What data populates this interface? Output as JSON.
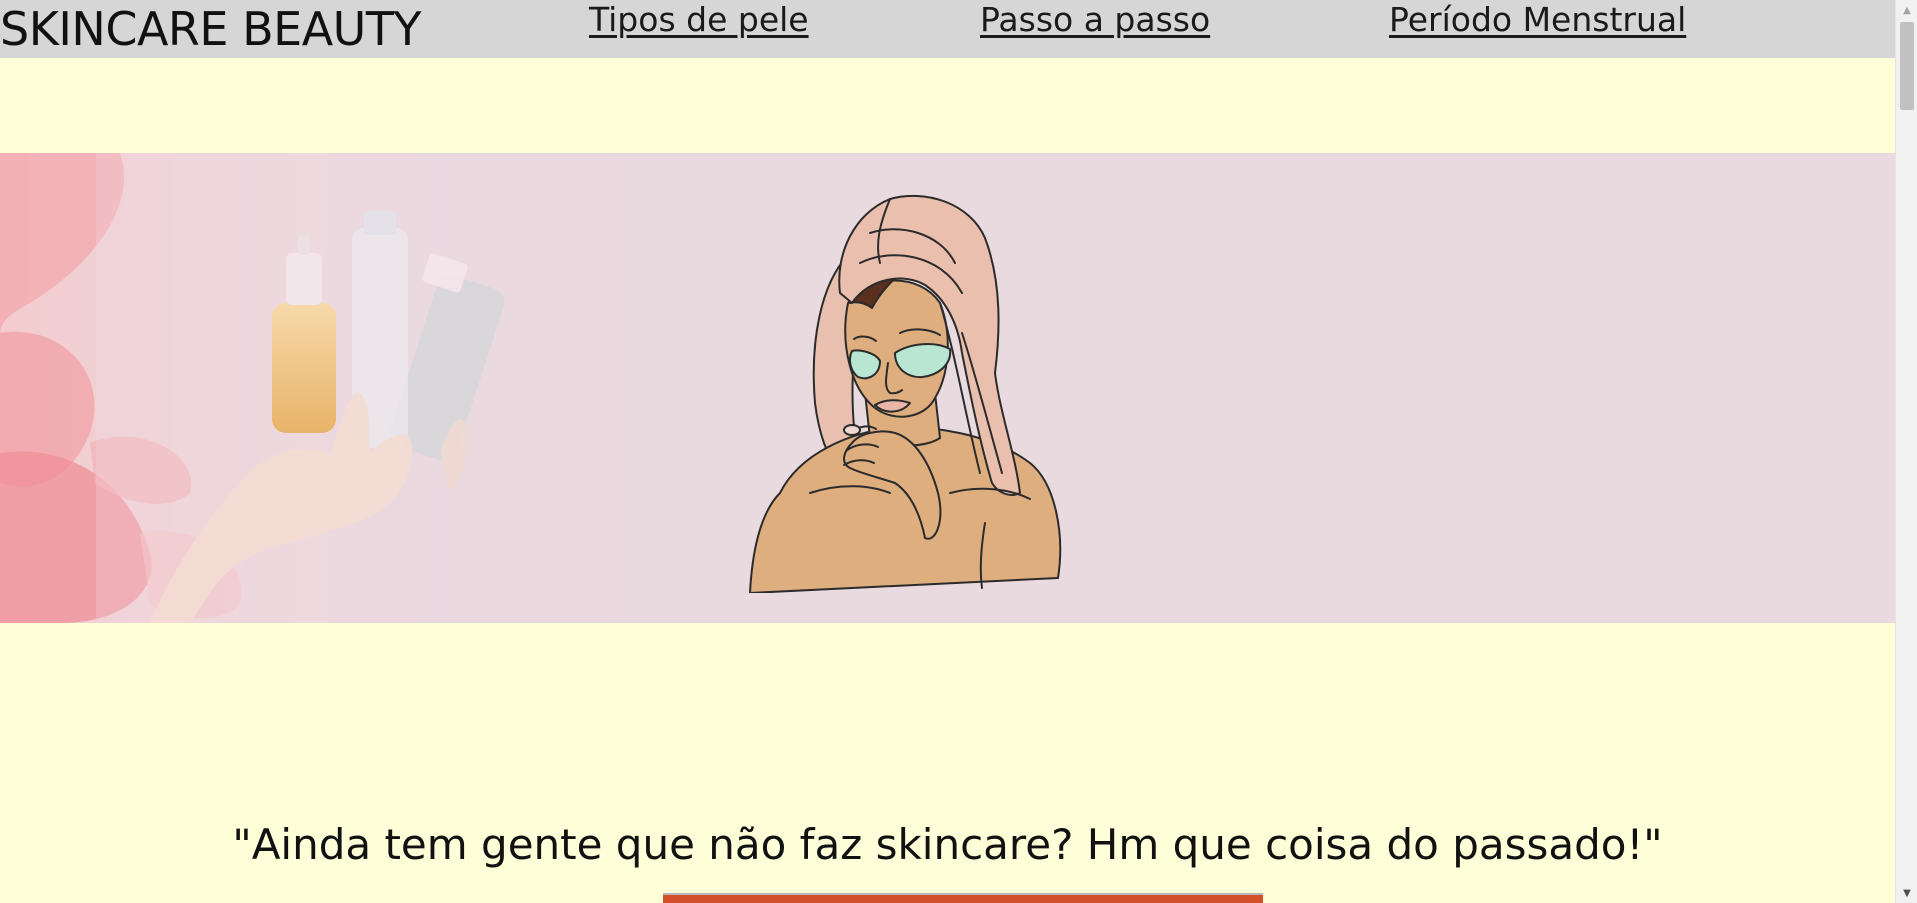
{
  "header": {
    "brand": "SKINCARE BEAUTY",
    "nav": [
      {
        "label": "Tipos de pele"
      },
      {
        "label": "Passo a passo"
      },
      {
        "label": "Período Menstrual"
      }
    ]
  },
  "hero": {
    "left_image_icon": "hand-holding-bottles-image",
    "illustration_icon": "woman-towel-eye-patches-illustration"
  },
  "main": {
    "quote": "\"Ainda tem gente que não faz skincare? Hm que coisa do passado!\""
  },
  "colors": {
    "page_background": "#fefed8",
    "navbar_background": "#d6d6d6",
    "hero_background": "#e8dadf"
  }
}
